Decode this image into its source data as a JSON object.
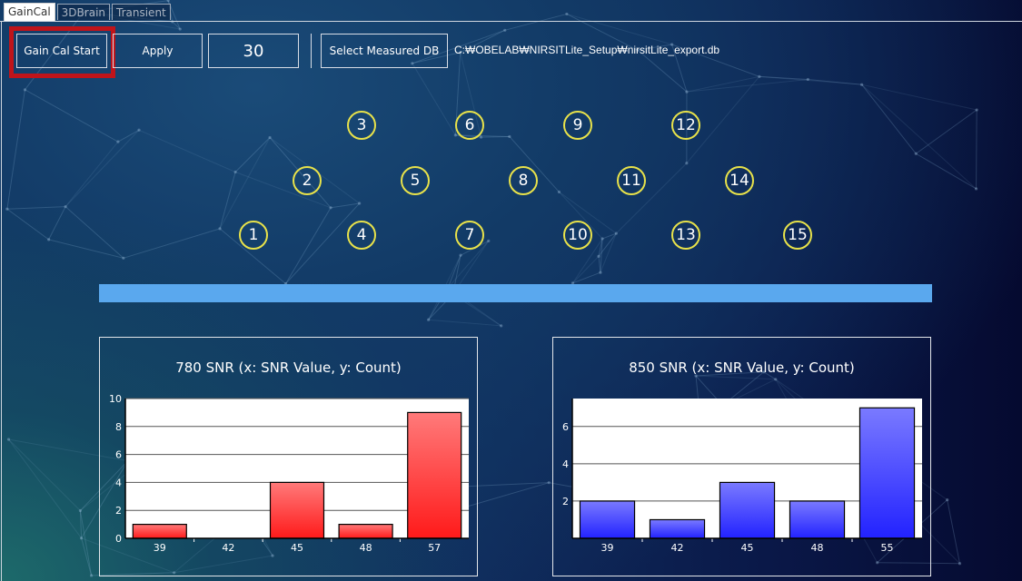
{
  "tabs": [
    {
      "label": "GainCal",
      "active": true
    },
    {
      "label": "3DBrain",
      "active": false
    },
    {
      "label": "Transient",
      "active": false
    }
  ],
  "toolbar": {
    "gain_cal_start_label": "Gain Cal Start",
    "apply_label": "Apply",
    "value": "30",
    "select_db_label": "Select Measured DB",
    "db_path": "C:₩OBELAB₩NIRSITLite_Setup₩nirsitLite_export.db"
  },
  "channels": [
    "1",
    "2",
    "3",
    "4",
    "5",
    "6",
    "7",
    "8",
    "9",
    "10",
    "11",
    "12",
    "13",
    "14",
    "15"
  ],
  "colors": {
    "highlight": "#c0141a",
    "channel_ring": "#e8e24a",
    "progress": "#5aa8ee",
    "bar780": "#ff1a1a",
    "bar850": "#2222ff"
  },
  "chart_data": [
    {
      "type": "bar",
      "title": "780 SNR (x: SNR Value, y: Count)",
      "categories": [
        "39",
        "42",
        "45",
        "48",
        "57"
      ],
      "values": [
        1,
        0,
        4,
        1,
        9
      ],
      "ylim": [
        0,
        10
      ],
      "yticks": [
        "0",
        "2",
        "4",
        "6",
        "8",
        "10"
      ],
      "grid": true
    },
    {
      "type": "bar",
      "title": "850 SNR (x: SNR Value, y: Count)",
      "categories": [
        "39",
        "42",
        "45",
        "48",
        "55"
      ],
      "values": [
        2,
        1,
        3,
        2,
        7
      ],
      "ylim": [
        0,
        7.5
      ],
      "yticks": [
        "2",
        "4",
        "6"
      ],
      "grid": true
    }
  ]
}
